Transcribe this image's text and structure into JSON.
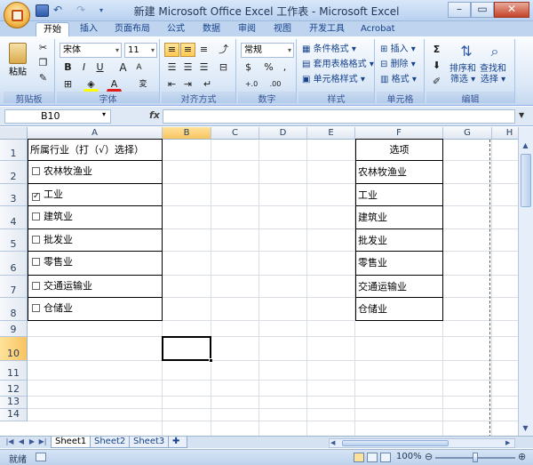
{
  "window": {
    "title": "新建 Microsoft Office Excel 工作表 - Microsoft Excel",
    "min": "–",
    "max": "▭",
    "close": "✕"
  },
  "ribbon": {
    "tabs": [
      "开始",
      "插入",
      "页面布局",
      "公式",
      "数据",
      "审阅",
      "视图",
      "开发工具",
      "Acrobat"
    ],
    "active_tab": "开始",
    "clipboard": {
      "paste": "粘贴",
      "label": "剪贴板"
    },
    "font": {
      "name": "宋体",
      "size": "11",
      "bold": "B",
      "italic": "I",
      "underline": "U",
      "grow": "A",
      "shrink": "A",
      "label": "字体"
    },
    "align": {
      "label": "对齐方式"
    },
    "number": {
      "format": "常规",
      "percent": "%",
      "comma": ",",
      "inc": "+.0",
      "dec": ".00",
      "label": "数字"
    },
    "styles": {
      "cond": "条件格式",
      "table": "套用表格格式",
      "cell": "单元格样式",
      "label": "样式"
    },
    "cells": {
      "insert": "插入",
      "delete": "删除",
      "format": "格式",
      "label": "单元格"
    },
    "edit": {
      "sigma": "Σ",
      "sort": "排序和",
      "sort2": "筛选",
      "find": "查找和",
      "find2": "选择",
      "label": "编辑"
    }
  },
  "formula_bar": {
    "name_box": "B10",
    "fx": "fx",
    "value": ""
  },
  "columns": [
    "A",
    "B",
    "C",
    "D",
    "E",
    "F",
    "G",
    "H"
  ],
  "rows": [
    "1",
    "2",
    "3",
    "4",
    "5",
    "6",
    "7",
    "8",
    "9",
    "10",
    "11",
    "12",
    "13",
    "14"
  ],
  "active": {
    "col": "B",
    "row": "10"
  },
  "sheet": {
    "a1": "所属行业（打（√）选择）",
    "checkboxes": [
      {
        "label": "农林牧渔业",
        "checked": false
      },
      {
        "label": "工业",
        "checked": true
      },
      {
        "label": "建筑业",
        "checked": false
      },
      {
        "label": "批发业",
        "checked": false
      },
      {
        "label": "零售业",
        "checked": false
      },
      {
        "label": "交通运输业",
        "checked": false
      },
      {
        "label": "仓储业",
        "checked": false
      }
    ],
    "check_mark": "✓",
    "f1": "选项",
    "options": [
      "农林牧渔业",
      "工业",
      "建筑业",
      "批发业",
      "零售业",
      "交通运输业",
      "仓储业"
    ]
  },
  "sheet_tabs": [
    "Sheet1",
    "Sheet2",
    "Sheet3"
  ],
  "status": {
    "text": "就绪",
    "zoom": "100%",
    "zoom_level_percent": 100
  }
}
